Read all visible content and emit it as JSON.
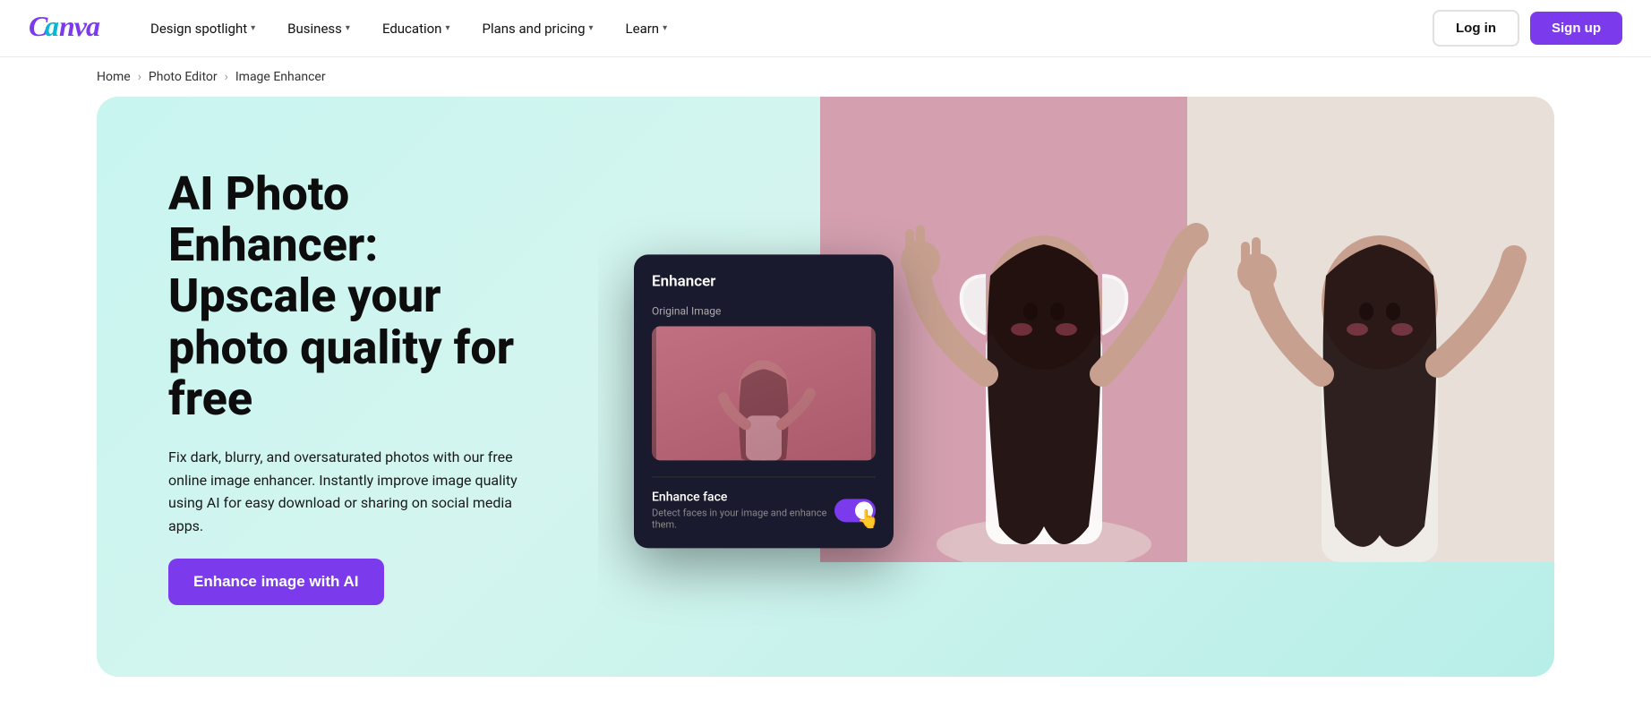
{
  "nav": {
    "logo": "Canva",
    "items": [
      {
        "label": "Design spotlight",
        "hasDropdown": true
      },
      {
        "label": "Business",
        "hasDropdown": true
      },
      {
        "label": "Education",
        "hasDropdown": true
      },
      {
        "label": "Plans and pricing",
        "hasDropdown": true
      },
      {
        "label": "Learn",
        "hasDropdown": true
      }
    ],
    "login_label": "Log in",
    "signup_label": "Sign up"
  },
  "breadcrumb": {
    "home": "Home",
    "parent": "Photo Editor",
    "current": "Image Enhancer"
  },
  "hero": {
    "title": "AI Photo Enhancer: Upscale your photo quality for free",
    "description": "Fix dark, blurry, and oversaturated photos with our free online image enhancer. Instantly improve image quality using AI for easy download or sharing on social media apps.",
    "cta_label": "Enhance image with AI"
  },
  "enhancer_card": {
    "title": "Enhancer",
    "original_image_label": "Original Image",
    "face_label": "Enhance face",
    "face_desc": "Detect faces in your image and enhance them.",
    "toggle_on": true
  }
}
